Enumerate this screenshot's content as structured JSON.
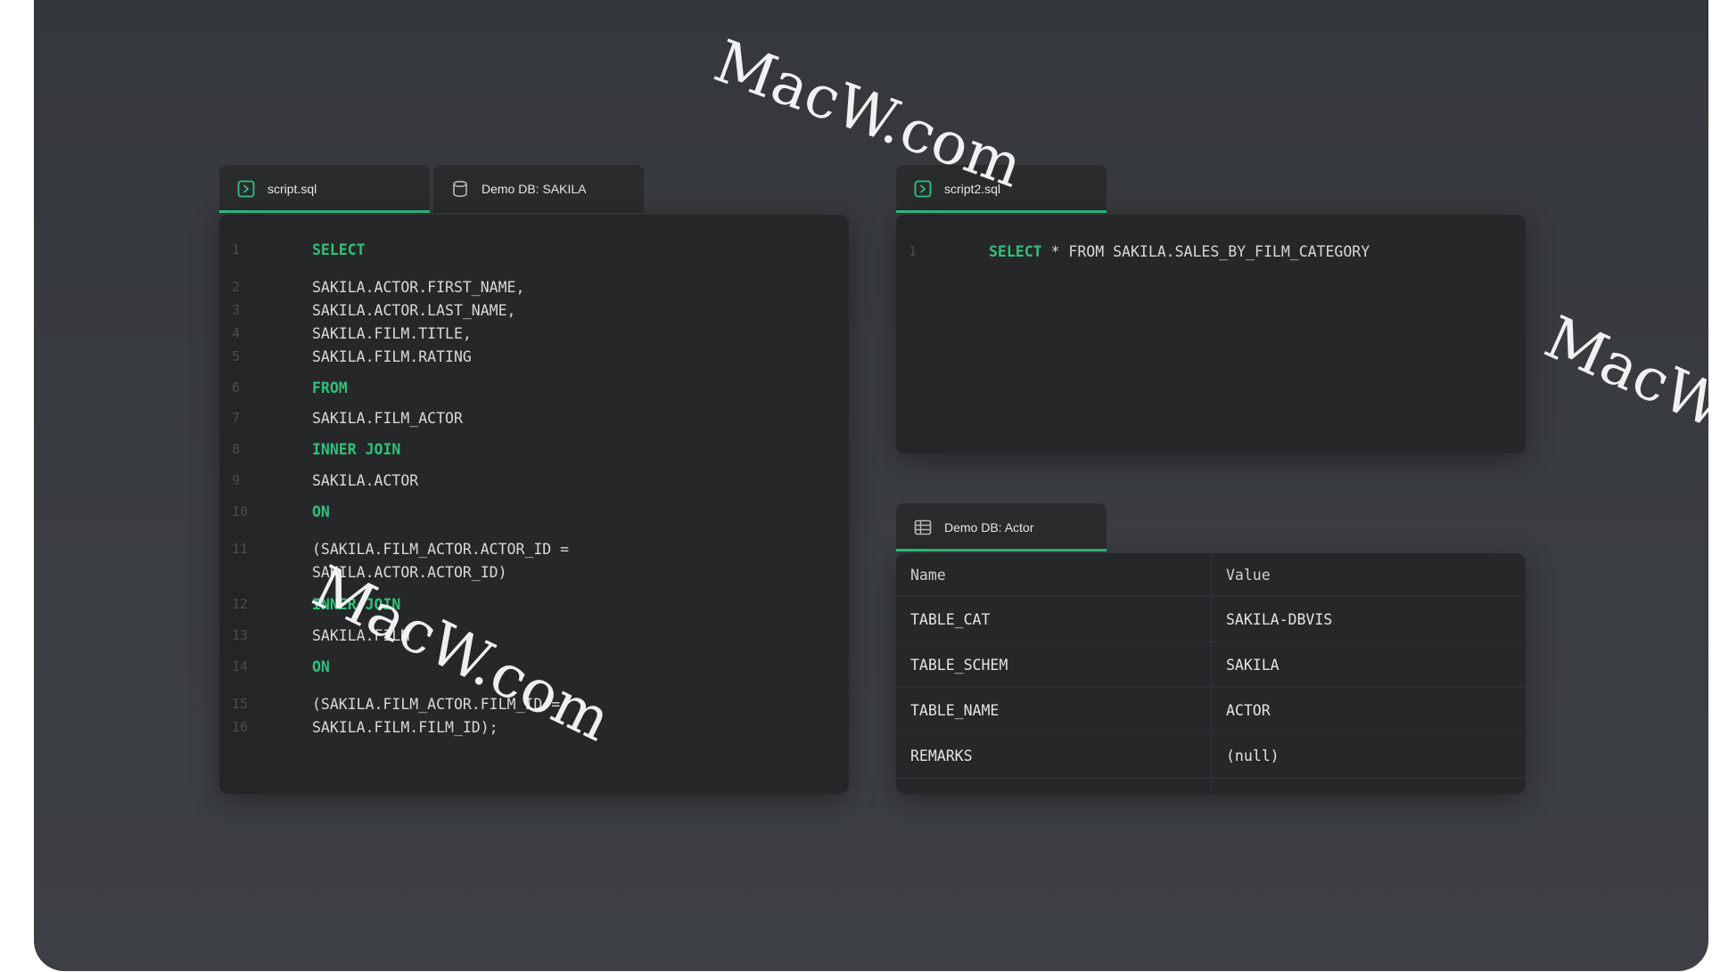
{
  "left_editor": {
    "tabs": [
      {
        "label": "script.sql",
        "icon": "script-icon",
        "active": true
      },
      {
        "label": "Demo DB: SAKILA",
        "icon": "database-icon",
        "active": false
      }
    ],
    "lines": [
      {
        "n": "1",
        "text": "SELECT",
        "kw": true
      },
      {
        "n": "2",
        "text": "SAKILA.ACTOR.FIRST_NAME,",
        "kw": false
      },
      {
        "n": "3",
        "text": "SAKILA.ACTOR.LAST_NAME,",
        "kw": false
      },
      {
        "n": "4",
        "text": "SAKILA.FILM.TITLE,",
        "kw": false
      },
      {
        "n": "5",
        "text": "SAKILA.FILM.RATING",
        "kw": false
      },
      {
        "n": "6",
        "text": "FROM",
        "kw": true
      },
      {
        "n": "7",
        "text": "SAKILA.FILM_ACTOR",
        "kw": false
      },
      {
        "n": "8",
        "text": "INNER JOIN",
        "kw": true
      },
      {
        "n": "9",
        "text": "SAKILA.ACTOR",
        "kw": false
      },
      {
        "n": "10",
        "text": "ON",
        "kw": true
      },
      {
        "n": "11",
        "text": "(SAKILA.FILM_ACTOR.ACTOR_ID =",
        "kw": false
      },
      {
        "n": "",
        "text": "SAKILA.ACTOR.ACTOR_ID)",
        "kw": false
      },
      {
        "n": "12",
        "text": "INNER JOIN",
        "kw": true
      },
      {
        "n": "13",
        "text": "SAKILA.FILM",
        "kw": false
      },
      {
        "n": "14",
        "text": "ON",
        "kw": true
      },
      {
        "n": "15",
        "text": "(SAKILA.FILM_ACTOR.FILM_ID =",
        "kw": false
      },
      {
        "n": "16",
        "text": "SAKILA.FILM.FILM_ID);",
        "kw": false
      }
    ]
  },
  "right_editor": {
    "tab": {
      "label": "script2.sql",
      "icon": "script-icon"
    },
    "line_number": "1",
    "keyword": "SELECT",
    "rest": " * FROM SAKILA.SALES_BY_FILM_CATEGORY"
  },
  "result_table": {
    "tab": {
      "label": "Demo DB: Actor",
      "icon": "table-grid-icon"
    },
    "columns": [
      "Name",
      "Value"
    ],
    "rows": [
      [
        "TABLE_CAT",
        "SAKILA-DBVIS"
      ],
      [
        "TABLE_SCHEM",
        "SAKILA"
      ],
      [
        "TABLE_NAME",
        "ACTOR"
      ],
      [
        "REMARKS",
        "(null)"
      ]
    ]
  },
  "watermark": "MacW.com",
  "colors": {
    "accent": "#2fc27a",
    "panel": "#262729",
    "background": "#383b40"
  }
}
